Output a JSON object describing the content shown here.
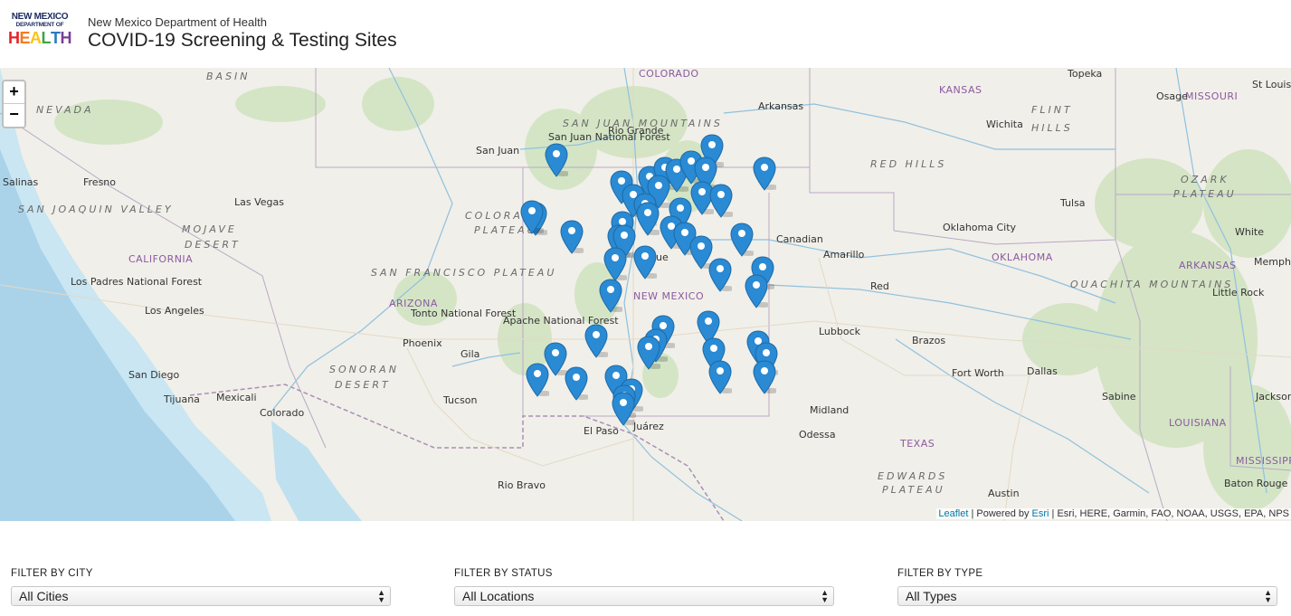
{
  "header": {
    "logo_line1": "NEW MEXICO",
    "logo_line2": "DEPARTMENT OF",
    "logo_line3": [
      "H",
      "E",
      "A",
      "L",
      "T",
      "H"
    ],
    "department": "New Mexico Department of Health",
    "title": "COVID-19 Screening & Testing Sites"
  },
  "map": {
    "zoom_in": "+",
    "zoom_out": "−",
    "attribution": {
      "leaflet": "Leaflet",
      "powered_by": " | Powered by ",
      "esri": "Esri",
      "sources": " | Esri, HERE, Garmin, FAO, NOAA, USGS, EPA, NPS"
    },
    "labels": [
      {
        "t": "BASIN",
        "k": "region"
      },
      {
        "t": "COLORADO",
        "k": "state"
      },
      {
        "t": "SAN JUAN MOUNTAINS",
        "k": "region"
      },
      {
        "t": "San Juan National Forest",
        "k": "city"
      },
      {
        "t": "NEVADA",
        "k": "region"
      },
      {
        "t": "Fresno",
        "k": "city"
      },
      {
        "t": "SAN JOAQUIN VALLEY",
        "k": "region"
      },
      {
        "t": "Las Vegas",
        "k": "city"
      },
      {
        "t": "MOJAVE",
        "k": "region"
      },
      {
        "t": "DESERT",
        "k": "region"
      },
      {
        "t": "CALIFORNIA",
        "k": "state"
      },
      {
        "t": "Los Padres National Forest",
        "k": "city"
      },
      {
        "t": "Los Angeles",
        "k": "city"
      },
      {
        "t": "San Diego",
        "k": "city"
      },
      {
        "t": "Tijuana",
        "k": "city"
      },
      {
        "t": "Mexicali",
        "k": "city"
      },
      {
        "t": "COLORADO",
        "k": "region"
      },
      {
        "t": "PLATEAU",
        "k": "region"
      },
      {
        "t": "SAN FRANCISCO PLATEAU",
        "k": "region"
      },
      {
        "t": "ARIZONA",
        "k": "state"
      },
      {
        "t": "Tonto National Forest",
        "k": "city"
      },
      {
        "t": "Phoenix",
        "k": "city"
      },
      {
        "t": "Apache National Forest",
        "k": "city"
      },
      {
        "t": "SONORAN",
        "k": "region"
      },
      {
        "t": "DESERT",
        "k": "region"
      },
      {
        "t": "Tucson",
        "k": "city"
      },
      {
        "t": "NEW MEXICO",
        "k": "state"
      },
      {
        "t": "El Paso",
        "k": "city"
      },
      {
        "t": "Juárez",
        "k": "city"
      },
      {
        "t": "KANSAS",
        "k": "state"
      },
      {
        "t": "Wichita",
        "k": "city"
      },
      {
        "t": "FLINT",
        "k": "region"
      },
      {
        "t": "HILLS",
        "k": "region"
      },
      {
        "t": "RED HILLS",
        "k": "region"
      },
      {
        "t": "Topeka",
        "k": "city"
      },
      {
        "t": "St Louis",
        "k": "city"
      },
      {
        "t": "MISSOURI",
        "k": "state"
      },
      {
        "t": "OZARK",
        "k": "region"
      },
      {
        "t": "PLATEAU",
        "k": "region"
      },
      {
        "t": "Tulsa",
        "k": "city"
      },
      {
        "t": "Oklahoma City",
        "k": "city"
      },
      {
        "t": "OKLAHOMA",
        "k": "state"
      },
      {
        "t": "ARKANSAS",
        "k": "state"
      },
      {
        "t": "Memph",
        "k": "city"
      },
      {
        "t": "OUACHITA MOUNTAINS",
        "k": "region"
      },
      {
        "t": "Little Rock",
        "k": "city"
      },
      {
        "t": "Amarillo",
        "k": "city"
      },
      {
        "t": "Lubbock",
        "k": "city"
      },
      {
        "t": "Fort Worth",
        "k": "city"
      },
      {
        "t": "Dallas",
        "k": "city"
      },
      {
        "t": "Midland",
        "k": "city"
      },
      {
        "t": "Odessa",
        "k": "city"
      },
      {
        "t": "TEXAS",
        "k": "state"
      },
      {
        "t": "EDWARDS",
        "k": "region"
      },
      {
        "t": "PLATEAU",
        "k": "region"
      },
      {
        "t": "Austin",
        "k": "city"
      },
      {
        "t": "LOUISIANA",
        "k": "state"
      },
      {
        "t": "MISSISSIPP",
        "k": "state"
      },
      {
        "t": "Baton Rouge",
        "k": "city"
      },
      {
        "t": "Jacksor",
        "k": "city"
      },
      {
        "t": "Canadian",
        "k": "city"
      },
      {
        "t": "Red",
        "k": "city"
      },
      {
        "t": "Arkansas",
        "k": "city"
      },
      {
        "t": "Rio Grande",
        "k": "city"
      },
      {
        "t": "Gila",
        "k": "city"
      },
      {
        "t": "Colorado",
        "k": "city"
      },
      {
        "t": "San Juan",
        "k": "city"
      },
      {
        "t": "Salinas",
        "k": "city"
      },
      {
        "t": "Sabine",
        "k": "city"
      },
      {
        "t": "Brazos",
        "k": "city"
      },
      {
        "t": "Osage",
        "k": "city"
      },
      {
        "t": "White",
        "k": "city"
      },
      {
        "t": "Rio Bravo",
        "k": "city"
      },
      {
        "t": "que",
        "k": "city"
      }
    ],
    "marker_color": "#2a8ad4",
    "marker_count": 49
  },
  "filters": [
    {
      "label": "FILTER BY CITY",
      "value": "All Cities"
    },
    {
      "label": "FILTER BY STATUS",
      "value": "All Locations"
    },
    {
      "label": "FILTER BY TYPE",
      "value": "All Types"
    }
  ]
}
